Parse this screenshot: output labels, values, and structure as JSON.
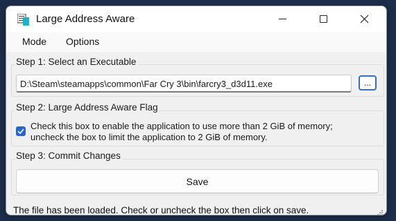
{
  "window": {
    "title": "Large Address Aware",
    "icon": "laa-app-icon",
    "controls": [
      "minimize-icon",
      "maximize-icon",
      "close-icon"
    ]
  },
  "menu": {
    "items": [
      {
        "label": "Mode"
      },
      {
        "label": "Options"
      }
    ]
  },
  "step1": {
    "label": "Step 1: Select an Executable",
    "path_value": "D:\\Steam\\steamapps\\common\\Far Cry 3\\bin\\farcry3_d3d11.exe",
    "browse_label": "..."
  },
  "step2": {
    "label": "Step 2: Large Address Aware Flag",
    "checked": true,
    "line1": "Check this box to enable the application to use more than 2 GiB of memory;",
    "line2": "uncheck the box to limit the application to 2 GiB of memory."
  },
  "step3": {
    "label": "Step 3: Commit Changes",
    "save_label": "Save"
  },
  "status": {
    "text": "The file has been loaded.  Check or uncheck the box then click on save."
  },
  "colors": {
    "accent": "#2a66c7",
    "background": "#1c2e4a"
  }
}
